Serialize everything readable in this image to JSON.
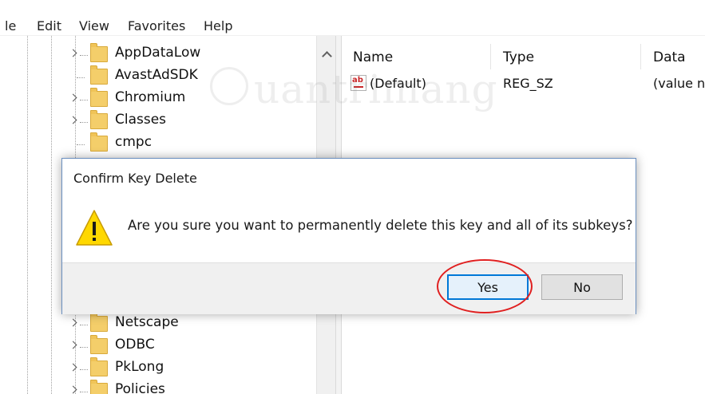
{
  "menubar": {
    "items": [
      "le",
      "Edit",
      "View",
      "Favorites",
      "Help"
    ]
  },
  "tree": {
    "items": [
      {
        "label": "AppDataLow",
        "expandable": true
      },
      {
        "label": "AvastAdSDK",
        "expandable": false
      },
      {
        "label": "Chromium",
        "expandable": true
      },
      {
        "label": "Classes",
        "expandable": true
      },
      {
        "label": "cmpc",
        "expandable": false
      },
      {
        "label": "Netscape",
        "expandable": true
      },
      {
        "label": "ODBC",
        "expandable": true
      },
      {
        "label": "PkLong",
        "expandable": true
      },
      {
        "label": "Policies",
        "expandable": true
      }
    ]
  },
  "list": {
    "columns": [
      "Name",
      "Type",
      "Data"
    ],
    "rows": [
      {
        "icon": "ab",
        "name": "(Default)",
        "type": "REG_SZ",
        "data": "(value n"
      }
    ]
  },
  "watermark": {
    "text": "uantrimang"
  },
  "dialog": {
    "title": "Confirm Key Delete",
    "message": "Are you sure you want to permanently delete this key and all of its subkeys?",
    "icon": "warning-icon",
    "buttons": {
      "yes": "Yes",
      "no": "No"
    }
  },
  "colors": {
    "accent": "#0078d7",
    "highlight_ring": "#e02020",
    "warning_fill": "#ffd800"
  }
}
